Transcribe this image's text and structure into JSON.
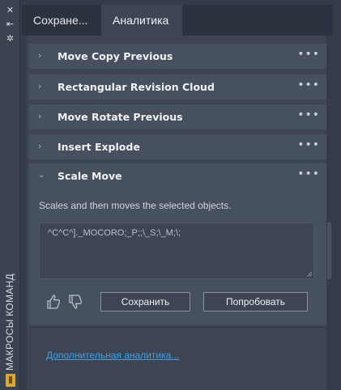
{
  "palette": {
    "panel_bg": "#3d4453",
    "row_bg": "#47505f",
    "tab_bar_bg": "#2d333e",
    "link": "#3aa3ea",
    "badge": "#d9a93b"
  },
  "side_strip": {
    "vertical_title": "МАКРОСЫ КОМАНД",
    "icons": [
      "close-icon",
      "auto-hide-icon",
      "properties-icon",
      "app-badge-icon"
    ]
  },
  "tabs": [
    {
      "label": "Сохране...",
      "active": false
    },
    {
      "label": "Аналитика",
      "active": true
    }
  ],
  "collapsed_items": [
    {
      "title": "Move Copy Previous",
      "menu": "•••"
    },
    {
      "title": "Rectangular Revision Cloud",
      "menu": "•••"
    },
    {
      "title": "Move Rotate Previous",
      "menu": "•••"
    },
    {
      "title": "Insert Explode",
      "menu": "•••"
    }
  ],
  "expanded_item": {
    "title": "Scale Move",
    "menu": "•••",
    "description": "Scales and then moves the selected objects.",
    "macro": "^C^C^]._MOCORO;_P;;\\_S;\\_M;\\;",
    "save_label": "Сохранить",
    "try_label": "Попробовать"
  },
  "footer": {
    "more_link": "Дополнительная аналитика..."
  }
}
